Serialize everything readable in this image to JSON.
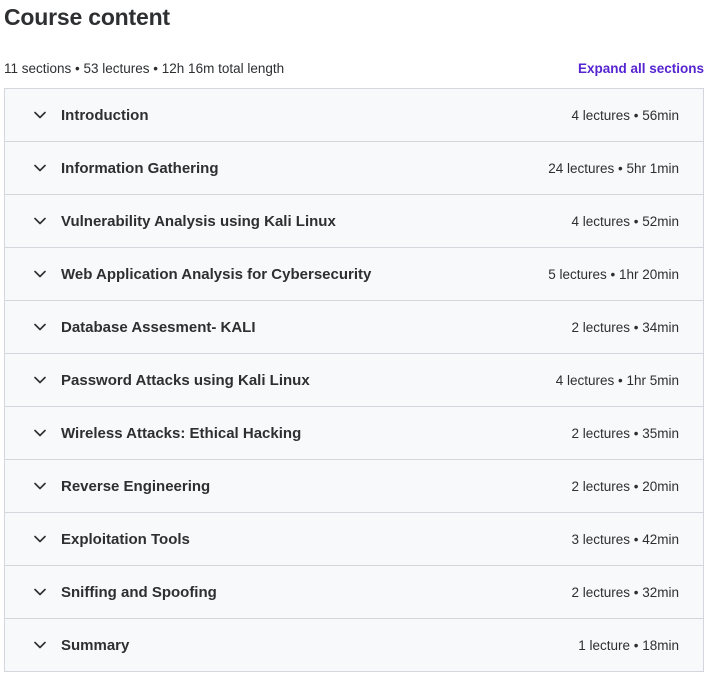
{
  "header": {
    "title": "Course content",
    "summary": "11 sections • 53 lectures • 12h 16m total length",
    "expand_label": "Expand all sections"
  },
  "sections": [
    {
      "title": "Introduction",
      "meta": "4 lectures • 56min"
    },
    {
      "title": "Information Gathering",
      "meta": "24 lectures • 5hr 1min"
    },
    {
      "title": "Vulnerability Analysis using Kali Linux",
      "meta": "4 lectures • 52min"
    },
    {
      "title": "Web Application Analysis for Cybersecurity",
      "meta": "5 lectures • 1hr 20min"
    },
    {
      "title": "Database Assesment- KALI",
      "meta": "2 lectures • 34min"
    },
    {
      "title": "Password Attacks using Kali Linux",
      "meta": "4 lectures • 1hr 5min"
    },
    {
      "title": "Wireless Attacks: Ethical Hacking",
      "meta": "2 lectures • 35min"
    },
    {
      "title": "Reverse Engineering",
      "meta": "2 lectures • 20min"
    },
    {
      "title": "Exploitation Tools",
      "meta": "3 lectures • 42min"
    },
    {
      "title": "Sniffing and Spoofing",
      "meta": "2 lectures • 32min"
    },
    {
      "title": "Summary",
      "meta": "1 lecture • 18min"
    }
  ],
  "icons": {
    "section_toggle": "chevron-down-icon"
  },
  "colors": {
    "accent": "#5624d0",
    "text": "#2d2f31",
    "section_bg": "#f7f9fa",
    "border": "#d1d7dc"
  }
}
